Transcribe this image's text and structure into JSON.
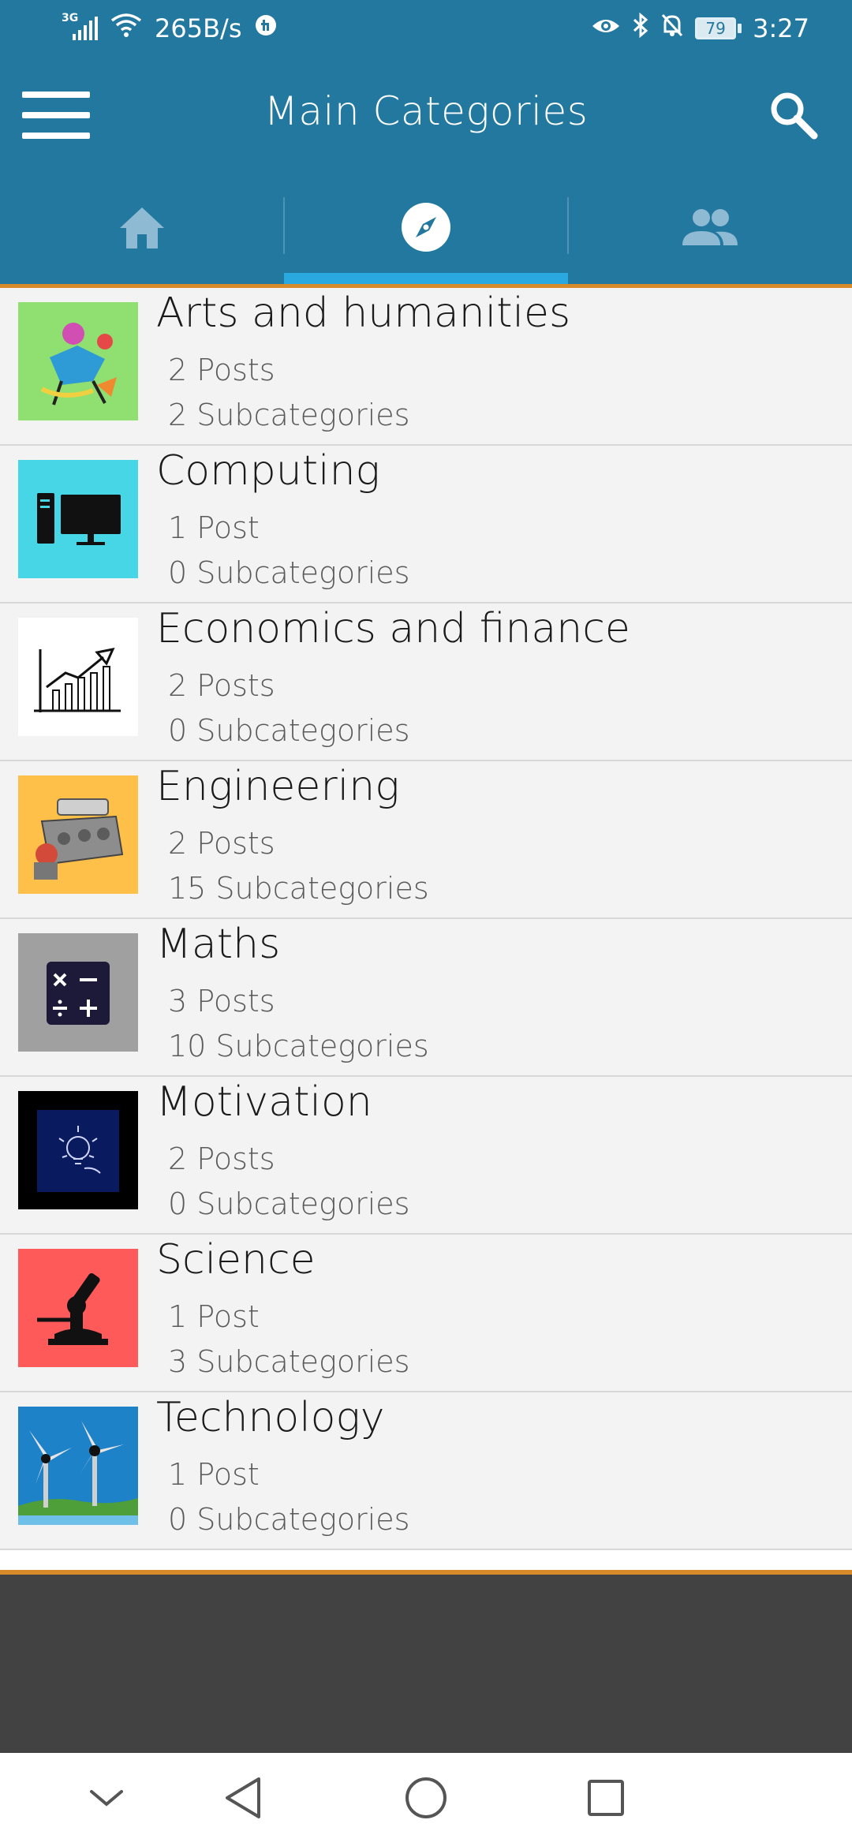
{
  "status_bar": {
    "network": "3G",
    "speed": "265B/s",
    "battery": "79",
    "time": "3:27"
  },
  "app_bar": {
    "title": "Main Categories"
  },
  "tabs": [
    {
      "icon": "home-icon",
      "active": false
    },
    {
      "icon": "compass-icon",
      "active": true
    },
    {
      "icon": "people-icon",
      "active": false
    }
  ],
  "colors": {
    "primary": "#23789f",
    "tab_indicator": "#2aa8e0",
    "accent_line": "#d68a2a",
    "list_bg": "#f3f3f3"
  },
  "categories": [
    {
      "name": "Arts and humanities",
      "posts": "2 Posts",
      "subcategories": "2 Subcategories"
    },
    {
      "name": "Computing",
      "posts": "1 Post",
      "subcategories": "0 Subcategories"
    },
    {
      "name": "Economics and finance",
      "posts": "2 Posts",
      "subcategories": "0 Subcategories"
    },
    {
      "name": "Engineering",
      "posts": "2 Posts",
      "subcategories": "15 Subcategories"
    },
    {
      "name": "Maths",
      "posts": "3 Posts",
      "subcategories": "10 Subcategories"
    },
    {
      "name": "Motivation",
      "posts": "2 Posts",
      "subcategories": "0 Subcategories"
    },
    {
      "name": "Science",
      "posts": "1 Post",
      "subcategories": "3 Subcategories"
    },
    {
      "name": "Technology",
      "posts": "1 Post",
      "subcategories": "0 Subcategories"
    }
  ]
}
